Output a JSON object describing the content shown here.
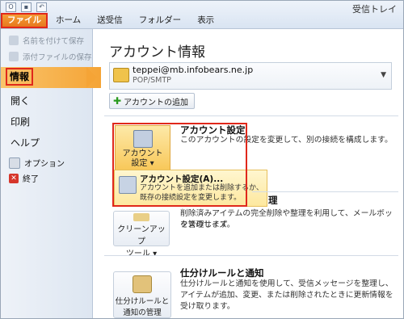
{
  "window": {
    "title": "受信トレイ"
  },
  "tabs": [
    {
      "label": "ファイル"
    },
    {
      "label": "ホーム"
    },
    {
      "label": "送受信"
    },
    {
      "label": "フォルダー"
    },
    {
      "label": "表示"
    }
  ],
  "sidebar": {
    "save_as": "名前を付けて保存",
    "save_attachments": "添付ファイルの保存",
    "info": "情報",
    "open": "開く",
    "print": "印刷",
    "help": "ヘルプ",
    "options": "オプション",
    "exit": "終了"
  },
  "main": {
    "title": "アカウント情報",
    "account": {
      "email": "teppei@mb.infobears.ne.jp",
      "type": "POP/SMTP"
    },
    "add_account": "アカウントの追加",
    "account_settings": {
      "button_line1": "アカウント",
      "button_line2": "設定",
      "title": "アカウント設定",
      "desc": "このアカウントの設定を変更して、別の接続を構成します。",
      "dropdown_title": "アカウント設定(A)...",
      "dropdown_desc": "アカウントを追加または削除するか、既存の接続設定を変更します。"
    },
    "cleanup": {
      "button_line1": "クリーンアップ",
      "button_line2": "ツール",
      "title_tail": "理",
      "desc_line1": "削除済みアイテムの完全削除や整理を利用して、メールボックスのサイズ",
      "desc_line2": "を管理します。"
    },
    "rules": {
      "button_line1": "仕分けルールと",
      "button_line2": "通知の管理",
      "title": "仕分けルールと通知",
      "desc": "仕分けルールと通知を使用して、受信メッセージを整理し、アイテムが追加、変更、または削除されたときに更新情報を受け取ります。"
    }
  },
  "colors": {
    "accent": "#f5a436",
    "highlight_outline": "#e0281b"
  }
}
